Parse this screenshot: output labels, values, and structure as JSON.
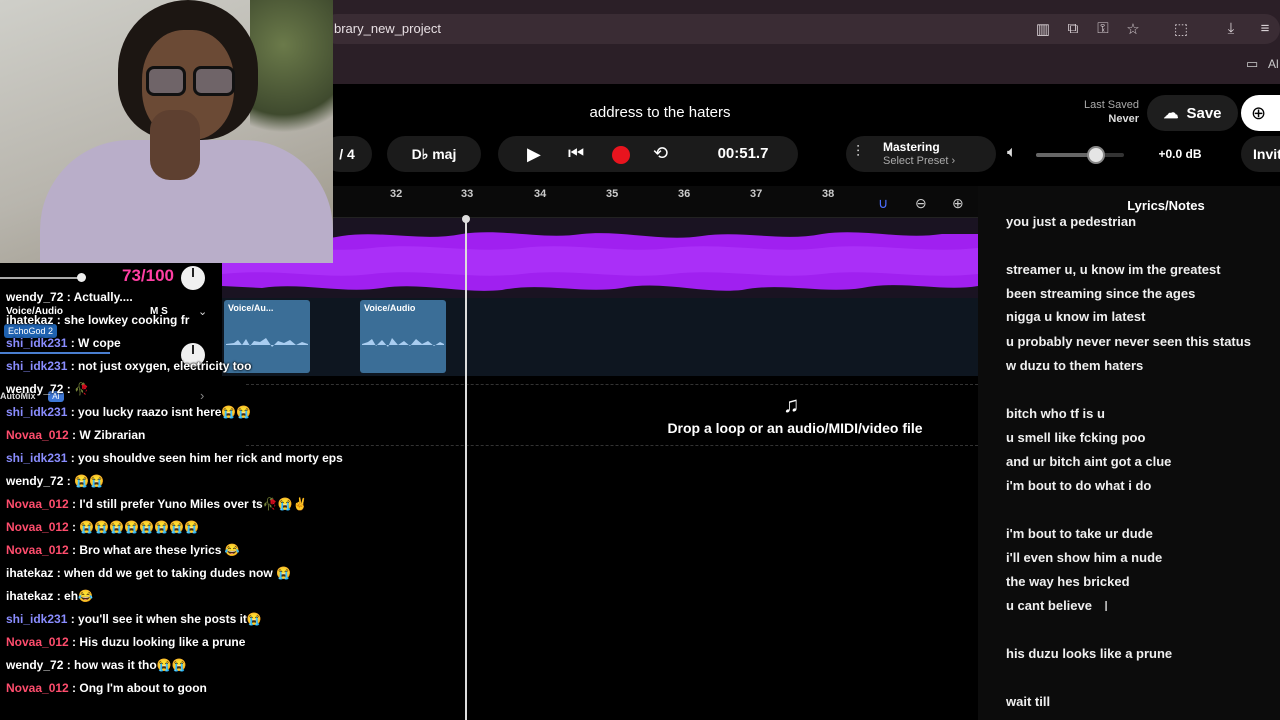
{
  "browser": {
    "url": "brary_new_project",
    "bookmark_partial": "Al"
  },
  "header": {
    "project_title": "address to the haters",
    "last_saved_label": "Last Saved",
    "last_saved_value": "Never",
    "save_label": "Save",
    "invite_label": "Invit"
  },
  "transport": {
    "time_signature": "/ 4",
    "key": "D♭ maj",
    "time": "00:51.7"
  },
  "mastering": {
    "title": "Mastering",
    "preset": "Select Preset ›"
  },
  "volume": {
    "db": "+0.0 dB",
    "level_fraction": 0.67
  },
  "ruler": {
    "bars": [
      "32",
      "33",
      "34",
      "35",
      "36",
      "37",
      "38"
    ]
  },
  "tracks": {
    "track2_name": "Voice/Audio",
    "clip1_label": "Voice/Au...",
    "clip2_label": "Voice/Audio",
    "ms_labels": "M  S",
    "automix_label": "AutoMix",
    "ai_badge": "AI"
  },
  "drop_zone": {
    "text": "Drop a loop or an audio/MIDI/video file"
  },
  "overlay": {
    "volume_readout": "73/100",
    "echo_tag": "EchoGod 2"
  },
  "lyrics": {
    "title": "Lyrics/Notes",
    "lines": [
      "you just a pedestrian",
      "streamer u, u know im the greatest",
      "been streaming since the ages",
      "nigga u know im latest",
      "u probably never never seen this status",
      "w duzu to them haters",
      "bitch who tf is u",
      "u smell like fcking poo",
      "and ur bitch aint got a clue",
      "i'm bout to do what i do",
      "i'm bout to take ur dude",
      "i'll even show him a nude",
      "the way hes bricked",
      "u cant believe",
      "his duzu looks like a prune",
      "wait till"
    ]
  },
  "chat": [
    {
      "user": "wendy_72",
      "msg": " : Actually....",
      "color": "#ffffff"
    },
    {
      "user": "ihatekaz",
      "msg": " : she lowkey cooking fr",
      "color": "#ffffff"
    },
    {
      "user": "shi_idk231",
      "msg": " : W cope",
      "color": "#8a8dff"
    },
    {
      "user": "shi_idk231",
      "msg": " : not just oxygen, electricity too",
      "color": "#8a8dff"
    },
    {
      "user": "wendy_72",
      "msg": " : 🥀",
      "color": "#ffffff"
    },
    {
      "user": "shi_idk231",
      "msg": " : you lucky raazo isnt here😭😭",
      "color": "#8a8dff"
    },
    {
      "user": "Novaa_012",
      "msg": " : W Zibrarian",
      "color": "#ff4d6d"
    },
    {
      "user": "shi_idk231",
      "msg": " : you shouldve seen him her rick and morty eps",
      "color": "#8a8dff"
    },
    {
      "user": "wendy_72",
      "msg": " : 😭😭",
      "color": "#ffffff"
    },
    {
      "user": "Novaa_012",
      "msg": " : I'd still prefer Yuno Miles over ts🥀😭✌",
      "color": "#ff4d6d"
    },
    {
      "user": "Novaa_012",
      "msg": " : 😭😭😭😭😭😭😭😭",
      "color": "#ff4d6d"
    },
    {
      "user": "Novaa_012",
      "msg": " : Bro what are these lyrics 😂",
      "color": "#ff4d6d"
    },
    {
      "user": "ihatekaz",
      "msg": " : when dd we get to taking dudes now 😭",
      "color": "#ffffff"
    },
    {
      "user": "ihatekaz",
      "msg": " : eh😂",
      "color": "#ffffff"
    },
    {
      "user": "shi_idk231",
      "msg": " : you'll see it when she posts it😭",
      "color": "#8a8dff"
    },
    {
      "user": "Novaa_012",
      "msg": " : His duzu looking like a prune",
      "color": "#ff4d6d"
    },
    {
      "user": "wendy_72",
      "msg": " : how was it tho😭😭",
      "color": "#ffffff"
    },
    {
      "user": "Novaa_012",
      "msg": " : Ong I'm about to goon",
      "color": "#ff4d6d"
    }
  ],
  "colors": {
    "accent_purple": "#a020f0",
    "clip_blue": "#3b6e97",
    "record_red": "#e8141e"
  }
}
